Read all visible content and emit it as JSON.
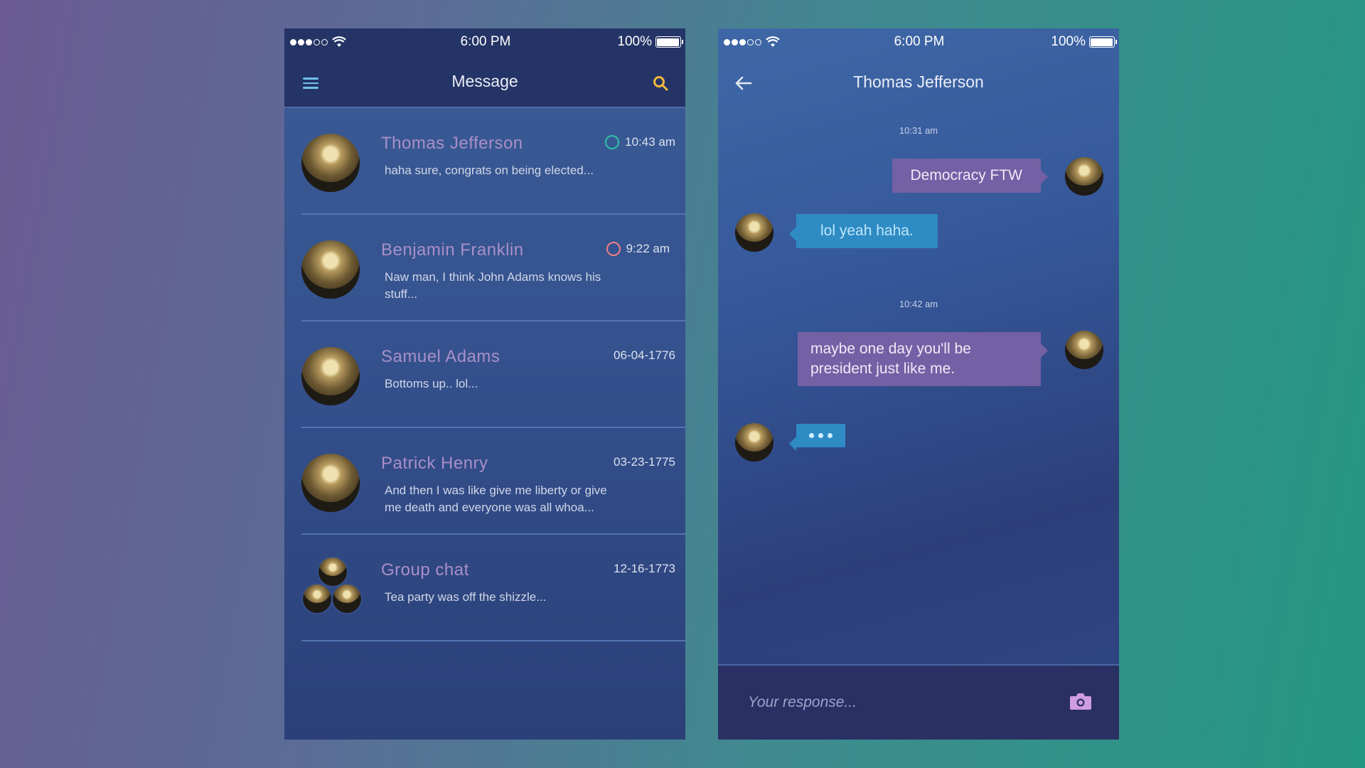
{
  "status_bar": {
    "time": "6:00 PM",
    "battery": "100%"
  },
  "list_screen": {
    "title": "Message",
    "conversations": [
      {
        "name": "Thomas Jefferson",
        "preview": "haha sure, congrats on being elected...",
        "time": "10:43 am",
        "status": "online"
      },
      {
        "name": "Benjamin Franklin",
        "preview": "Naw man, I think John Adams knows his stuff...",
        "time": "9:22 am",
        "status": "away"
      },
      {
        "name": "Samuel Adams",
        "preview": "Bottoms up.. lol...",
        "time": "06-04-1776"
      },
      {
        "name": "Patrick Henry",
        "preview": "And then I was like give me liberty or give me death and everyone was all whoa...",
        "time": "03-23-1775"
      },
      {
        "name": "Group chat",
        "preview": "Tea party was off the shizzle...",
        "time": "12-16-1773"
      }
    ]
  },
  "chat_screen": {
    "title": "Thomas Jefferson",
    "messages": [
      {
        "timestamp": "10:31 am"
      },
      {
        "direction": "out",
        "text": "Democracy FTW"
      },
      {
        "direction": "in",
        "text": "lol yeah haha."
      },
      {
        "timestamp": "10:42 am"
      },
      {
        "direction": "out",
        "text": "maybe one day you'll be president just like me."
      },
      {
        "direction": "in",
        "typing": true
      }
    ],
    "composer": {
      "placeholder": "Your response..."
    }
  },
  "colors": {
    "online": "#2fc3a4",
    "away": "#ef7f86",
    "outgoing_bubble": "#7460a4",
    "incoming_bubble": "#2f8bc4",
    "accent_name": "#a98fc8"
  },
  "icons": [
    "wifi-icon",
    "menu-icon",
    "search-icon",
    "back-arrow-icon",
    "camera-icon"
  ]
}
